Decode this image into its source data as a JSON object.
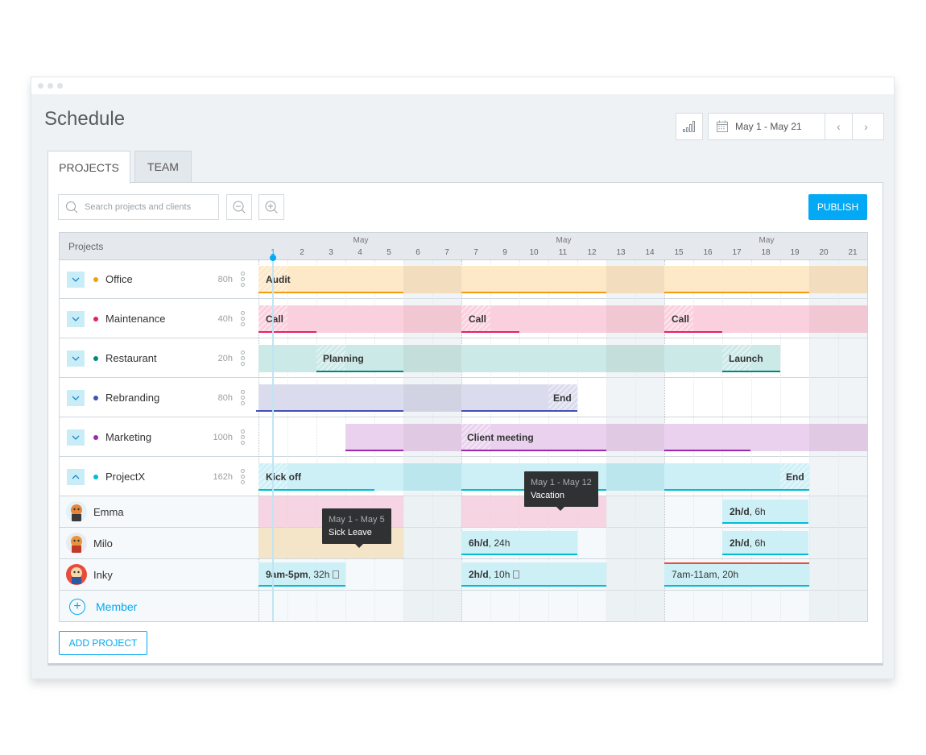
{
  "window": {
    "title": "Schedule"
  },
  "toolbar": {
    "stats_icon": "bar-chart-icon",
    "date_range": "May 1 - May 21",
    "calendar_icon": "calendar-icon",
    "prev_label": "‹",
    "next_label": "›"
  },
  "tabs": [
    {
      "label": "PROJECTS",
      "active": true
    },
    {
      "label": "TEAM",
      "active": false
    }
  ],
  "search": {
    "placeholder": "Search projects and clients"
  },
  "publish_label": "PUBLISH",
  "grid": {
    "header_label": "Projects",
    "months": [
      "May",
      "May",
      "May"
    ],
    "days": [
      "1",
      "2",
      "3",
      "4",
      "5",
      "6",
      "7",
      "7",
      "9",
      "10",
      "11",
      "12",
      "13",
      "14",
      "15",
      "16",
      "17",
      "18",
      "19",
      "20",
      "21"
    ],
    "today_day": "1"
  },
  "projects": [
    {
      "name": "Office",
      "hours": "80h",
      "color": "#f39c12",
      "expanded": false
    },
    {
      "name": "Maintenance",
      "hours": "40h",
      "color": "#e91e63",
      "expanded": false
    },
    {
      "name": "Restaurant",
      "hours": "20h",
      "color": "#00897b",
      "expanded": false
    },
    {
      "name": "Rebranding",
      "hours": "80h",
      "color": "#3f51b5",
      "expanded": false
    },
    {
      "name": "Marketing",
      "hours": "100h",
      "color": "#9c27b0",
      "expanded": false
    },
    {
      "name": "ProjectX",
      "hours": "162h",
      "color": "#00bcd4",
      "expanded": true
    }
  ],
  "bars": {
    "office": {
      "label": "Audit"
    },
    "maintenance": {
      "labels": [
        "Call",
        "Call",
        "Call"
      ]
    },
    "restaurant": {
      "labels": [
        "Planning",
        "Launch"
      ]
    },
    "rebranding": {
      "label": "End"
    },
    "marketing": {
      "label": "Client meeting"
    },
    "projectx": {
      "labels": [
        "Kick off",
        "End"
      ]
    }
  },
  "members": [
    {
      "name": "Emma",
      "avatar": "emma-avatar"
    },
    {
      "name": "Milo",
      "avatar": "milo-avatar"
    },
    {
      "name": "Inky",
      "avatar": "inky-avatar"
    }
  ],
  "assignments": {
    "emma": {
      "bold": "2h/d",
      "rest": ", 6h"
    },
    "milo_a": {
      "bold": "6h/d",
      "rest": ", 24h"
    },
    "milo_b": {
      "bold": "2h/d",
      "rest": ", 6h"
    },
    "inky_a": {
      "bold": "9am-5pm",
      "rest": ", 32h"
    },
    "inky_b": {
      "bold": "2h/d",
      "rest": ", 10h"
    },
    "inky_c": {
      "bold": "",
      "rest": "7am-11am, 20h"
    }
  },
  "tooltips": {
    "sick": {
      "dates": "May 1 - May 5",
      "label": "Sick Leave"
    },
    "vacation": {
      "dates": "May 1 - May 12",
      "label": "Vacation"
    }
  },
  "add_member_label": "Member",
  "add_project_label": "ADD PROJECT"
}
